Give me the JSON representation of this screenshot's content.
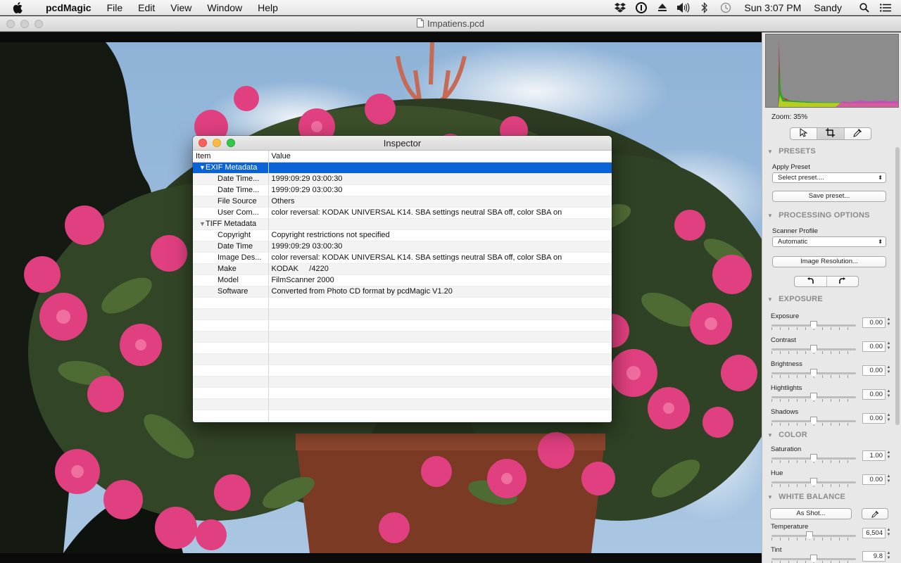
{
  "menubar": {
    "app_name": "pcdMagic",
    "items": [
      "File",
      "Edit",
      "View",
      "Window",
      "Help"
    ],
    "clock": "Sun 3:07 PM",
    "user": "Sandy"
  },
  "window": {
    "title": "Impatiens.pcd"
  },
  "inspector": {
    "title": "Inspector",
    "columns": {
      "item": "Item",
      "value": "Value"
    },
    "groups": {
      "exif": "EXIF Metadata",
      "tiff": "TIFF Metadata"
    },
    "rows": [
      {
        "item": "Date Time...",
        "value": "1999:09:29 03:00:30"
      },
      {
        "item": "Date Time...",
        "value": "1999:09:29 03:00:30"
      },
      {
        "item": "File Source",
        "value": "Others"
      },
      {
        "item": "User Com...",
        "value": "color reversal: KODAK UNIVERSAL K14. SBA settings neutral SBA off, color SBA on"
      },
      {
        "item": "Copyright",
        "value": "Copyright restrictions not specified"
      },
      {
        "item": "Date Time",
        "value": "1999:09:29 03:00:30"
      },
      {
        "item": "Image Des...",
        "value": "color reversal: KODAK UNIVERSAL K14. SBA settings neutral SBA off, color SBA on"
      },
      {
        "item": "Make",
        "value": "KODAK     /4220"
      },
      {
        "item": "Model",
        "value": "FilmScanner 2000"
      },
      {
        "item": "Software",
        "value": "Converted from Photo CD format by pcdMagic V1.20"
      }
    ]
  },
  "sidebar": {
    "zoom": "Zoom: 35%",
    "presets": {
      "header": "PRESETS",
      "apply_label": "Apply Preset",
      "select_value": "Select preset....",
      "save_button": "Save preset..."
    },
    "processing": {
      "header": "PROCESSING OPTIONS",
      "profile_label": "Scanner Profile",
      "profile_value": "Automatic",
      "resolution_button": "Image Resolution..."
    },
    "exposure": {
      "header": "EXPOSURE",
      "controls": [
        {
          "label": "Exposure",
          "value": "0.00",
          "level": 0.5
        },
        {
          "label": "Contrast",
          "value": "0.00",
          "level": 0.5
        },
        {
          "label": "Brightness",
          "value": "0.00",
          "level": 0.5
        },
        {
          "label": "Hightlights",
          "value": "0.00",
          "level": 0.5
        },
        {
          "label": "Shadows",
          "value": "0.00",
          "level": 0.5
        }
      ]
    },
    "color": {
      "header": "COLOR",
      "controls": [
        {
          "label": "Saturation",
          "value": "1.00",
          "level": 0.5
        },
        {
          "label": "Hue",
          "value": "0.00",
          "level": 0.5
        }
      ]
    },
    "white_balance": {
      "header": "WHITE BALANCE",
      "as_shot_button": "As Shot...",
      "controls": [
        {
          "label": "Temperature",
          "value": "6,504",
          "level": 0.45
        },
        {
          "label": "Tint",
          "value": "9.8",
          "level": 0.5
        }
      ]
    }
  }
}
